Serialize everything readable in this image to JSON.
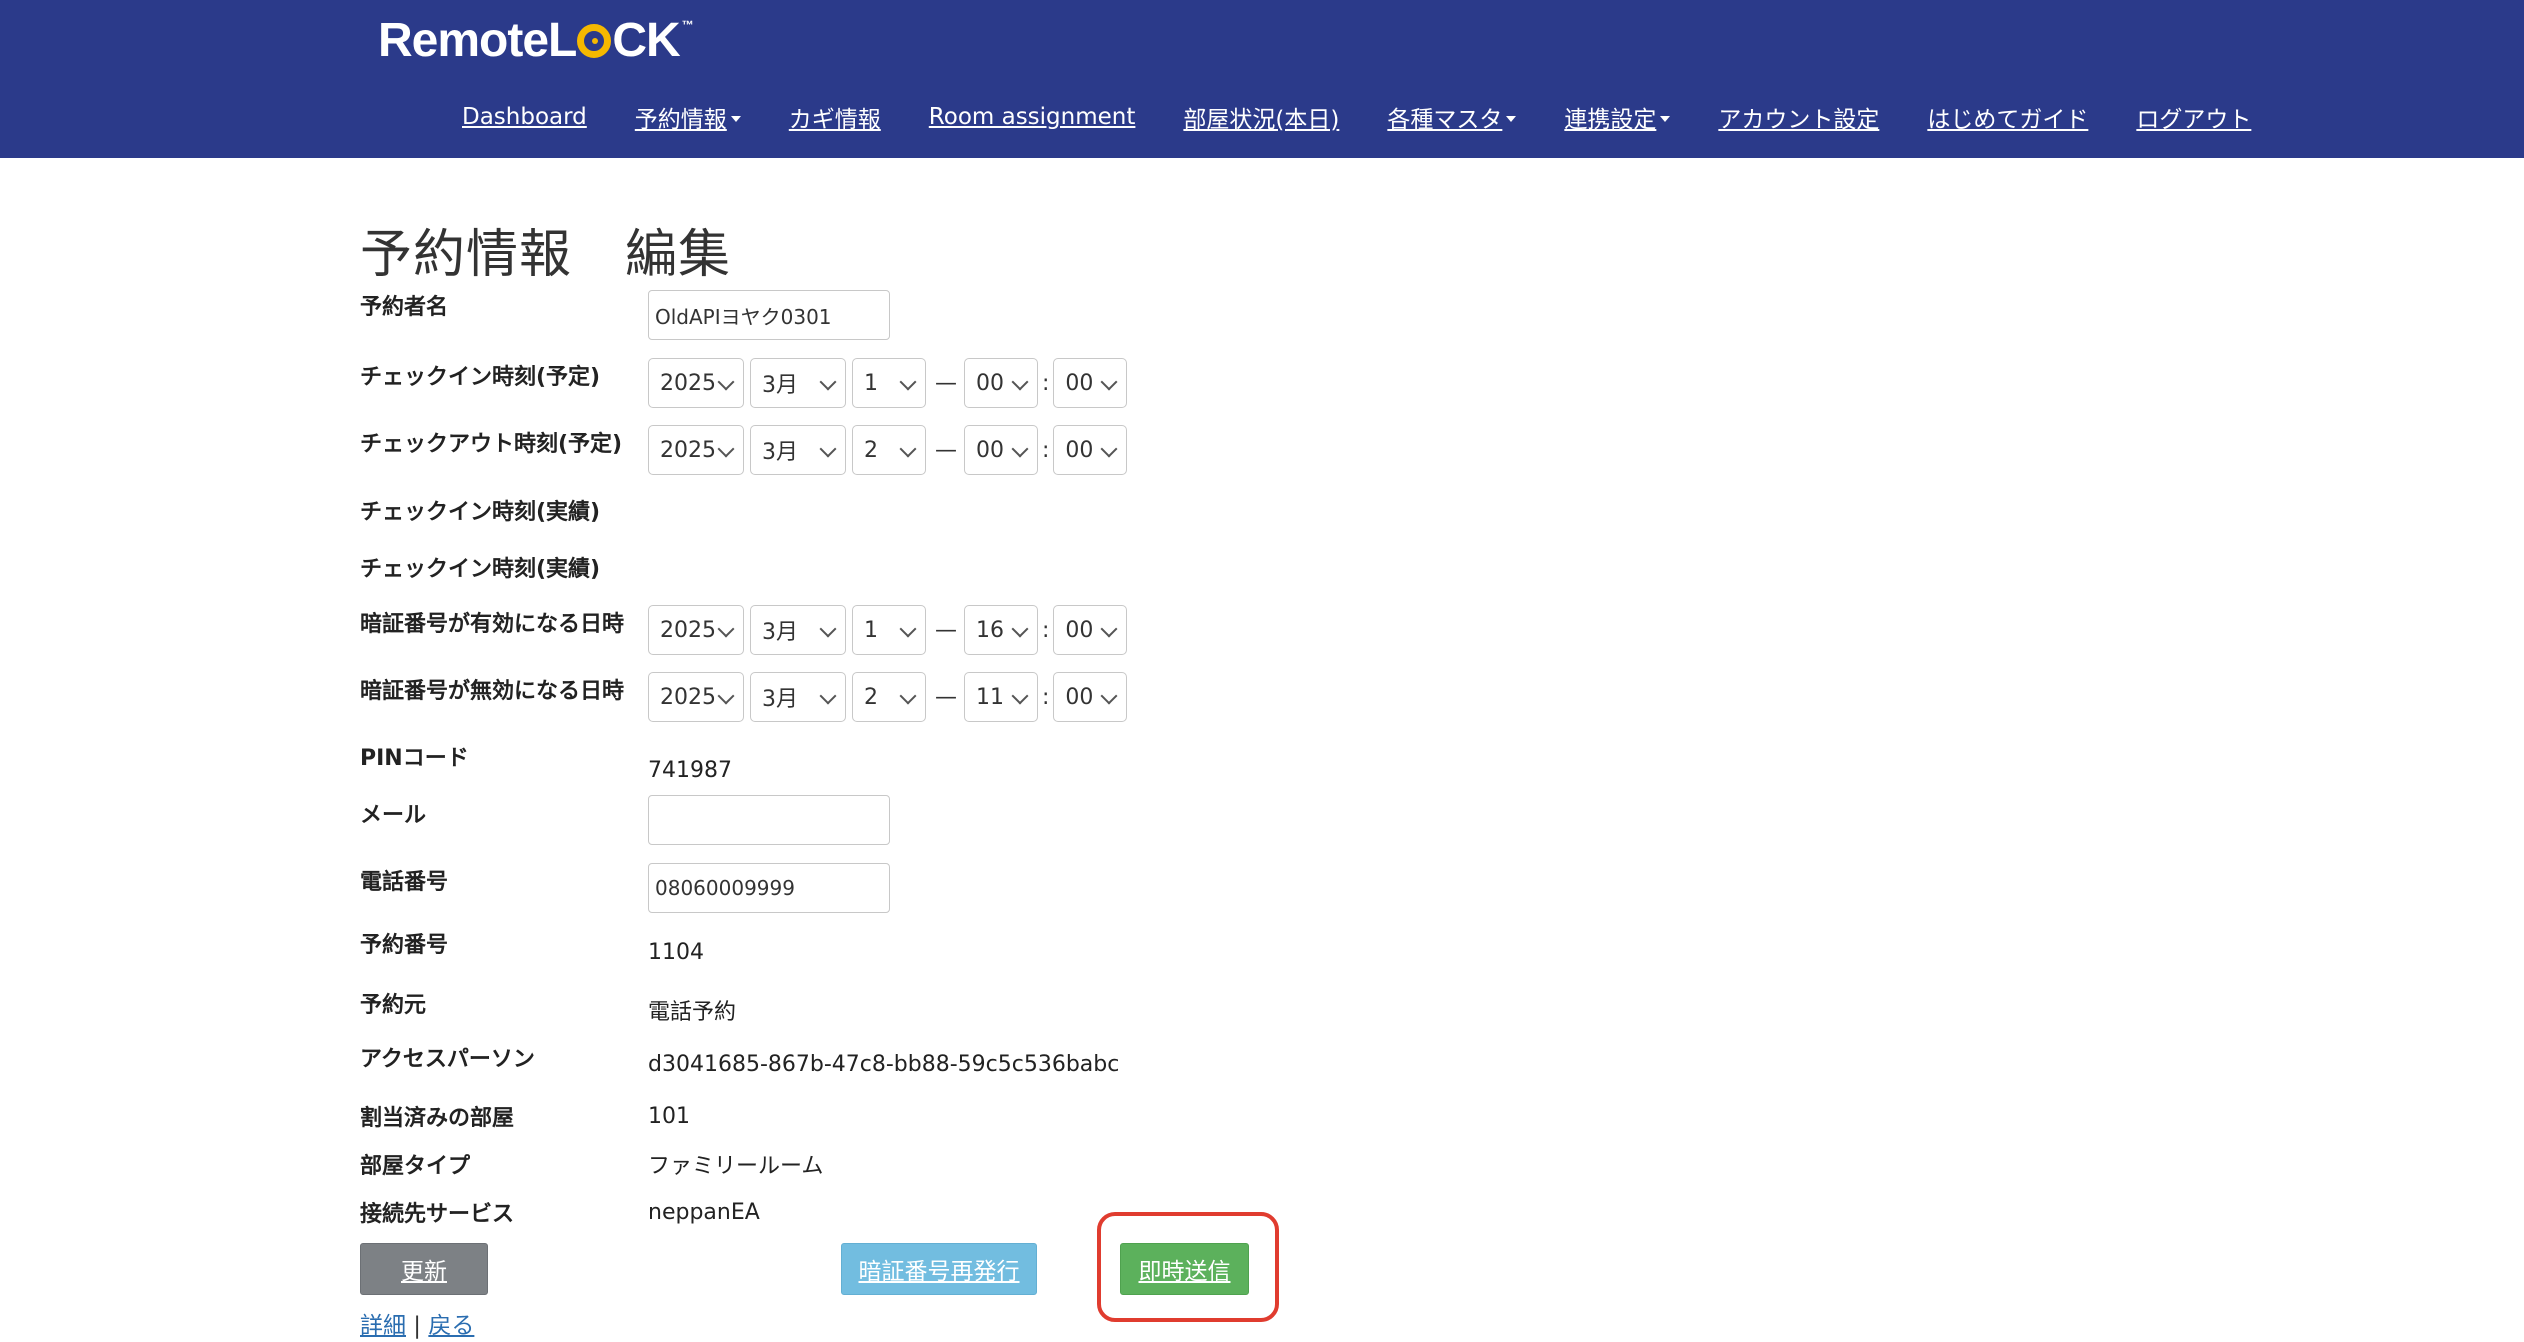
{
  "brand": {
    "logo_prefix": "Remote",
    "logo_l": "L",
    "logo_ck": "CK",
    "tm": "™"
  },
  "nav": {
    "dashboard": "Dashboard",
    "reservations": "予約情報",
    "keys": "カギ情報",
    "room_assignment": "Room assignment",
    "room_status": "部屋状況(本日)",
    "masters": "各種マスタ",
    "integrations": "連携設定",
    "account": "アカウント設定",
    "guide": "はじめてガイド",
    "logout": "ログアウト"
  },
  "page_title": "予約情報　編集",
  "form": {
    "guest_name": {
      "label": "予約者名",
      "value": "OldAPIヨヤク0301"
    },
    "checkin_planned": {
      "label": "チェックイン時刻(予定)",
      "year": "2025",
      "month": "3月",
      "day": "1",
      "hour": "00",
      "minute": "00"
    },
    "checkout_planned": {
      "label": "チェックアウト時刻(予定)",
      "year": "2025",
      "month": "3月",
      "day": "2",
      "hour": "00",
      "minute": "00"
    },
    "checkin_actual": {
      "label": "チェックイン時刻(実績)"
    },
    "checkin_actual2": {
      "label": "チェックイン時刻(実績)"
    },
    "pin_valid_from": {
      "label": "暗証番号が有効になる日時",
      "year": "2025",
      "month": "3月",
      "day": "1",
      "hour": "16",
      "minute": "00"
    },
    "pin_valid_until": {
      "label": "暗証番号が無効になる日時",
      "year": "2025",
      "month": "3月",
      "day": "2",
      "hour": "11",
      "minute": "00"
    },
    "pin_code": {
      "label": "PINコード",
      "value": "741987"
    },
    "email": {
      "label": "メール",
      "value": ""
    },
    "phone": {
      "label": "電話番号",
      "value": "08060009999"
    },
    "reservation_number": {
      "label": "予約番号",
      "value": "1104"
    },
    "source": {
      "label": "予約元",
      "value": "電話予約"
    },
    "access_person": {
      "label": "アクセスパーソン",
      "value": "d3041685-867b-47c8-bb88-59c5c536babc"
    },
    "assigned_room": {
      "label": "割当済みの部屋",
      "value": "101"
    },
    "room_type": {
      "label": "部屋タイプ",
      "value": "ファミリールーム"
    },
    "service": {
      "label": "接続先サービス",
      "value": "neppanEA"
    }
  },
  "buttons": {
    "update": "更新",
    "reissue_pin": "暗証番号再発行",
    "send_now": "即時送信"
  },
  "footer": {
    "detail": "詳細",
    "separator": " | ",
    "back": "戻る"
  },
  "colors": {
    "header": "#2b3a8a",
    "logo_accent": "#f5b800",
    "update_btn": "#7d8185",
    "reissue_btn": "#72bde0",
    "send_btn": "#5cb15c",
    "highlight": "#e03c2f"
  }
}
